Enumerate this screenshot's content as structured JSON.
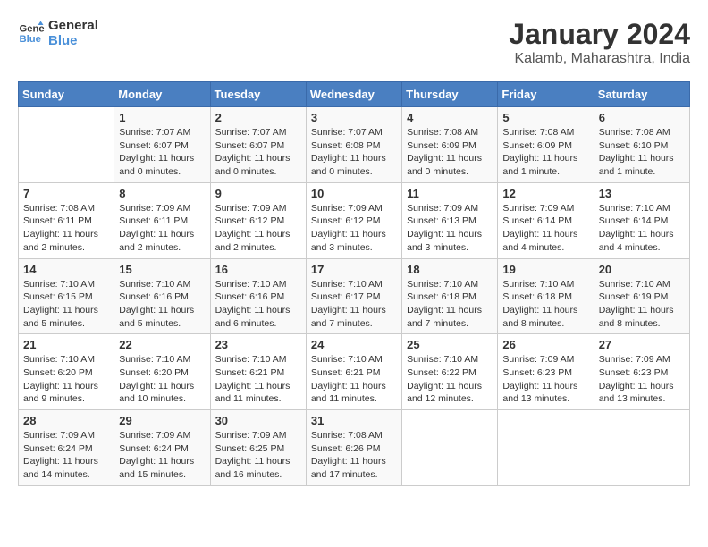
{
  "logo": {
    "line1": "General",
    "line2": "Blue"
  },
  "title": "January 2024",
  "location": "Kalamb, Maharashtra, India",
  "days_of_week": [
    "Sunday",
    "Monday",
    "Tuesday",
    "Wednesday",
    "Thursday",
    "Friday",
    "Saturday"
  ],
  "weeks": [
    [
      {
        "day": "",
        "info": ""
      },
      {
        "day": "1",
        "info": "Sunrise: 7:07 AM\nSunset: 6:07 PM\nDaylight: 11 hours\nand 0 minutes."
      },
      {
        "day": "2",
        "info": "Sunrise: 7:07 AM\nSunset: 6:07 PM\nDaylight: 11 hours\nand 0 minutes."
      },
      {
        "day": "3",
        "info": "Sunrise: 7:07 AM\nSunset: 6:08 PM\nDaylight: 11 hours\nand 0 minutes."
      },
      {
        "day": "4",
        "info": "Sunrise: 7:08 AM\nSunset: 6:09 PM\nDaylight: 11 hours\nand 0 minutes."
      },
      {
        "day": "5",
        "info": "Sunrise: 7:08 AM\nSunset: 6:09 PM\nDaylight: 11 hours\nand 1 minute."
      },
      {
        "day": "6",
        "info": "Sunrise: 7:08 AM\nSunset: 6:10 PM\nDaylight: 11 hours\nand 1 minute."
      }
    ],
    [
      {
        "day": "7",
        "info": "Sunrise: 7:08 AM\nSunset: 6:11 PM\nDaylight: 11 hours\nand 2 minutes."
      },
      {
        "day": "8",
        "info": "Sunrise: 7:09 AM\nSunset: 6:11 PM\nDaylight: 11 hours\nand 2 minutes."
      },
      {
        "day": "9",
        "info": "Sunrise: 7:09 AM\nSunset: 6:12 PM\nDaylight: 11 hours\nand 2 minutes."
      },
      {
        "day": "10",
        "info": "Sunrise: 7:09 AM\nSunset: 6:12 PM\nDaylight: 11 hours\nand 3 minutes."
      },
      {
        "day": "11",
        "info": "Sunrise: 7:09 AM\nSunset: 6:13 PM\nDaylight: 11 hours\nand 3 minutes."
      },
      {
        "day": "12",
        "info": "Sunrise: 7:09 AM\nSunset: 6:14 PM\nDaylight: 11 hours\nand 4 minutes."
      },
      {
        "day": "13",
        "info": "Sunrise: 7:10 AM\nSunset: 6:14 PM\nDaylight: 11 hours\nand 4 minutes."
      }
    ],
    [
      {
        "day": "14",
        "info": "Sunrise: 7:10 AM\nSunset: 6:15 PM\nDaylight: 11 hours\nand 5 minutes."
      },
      {
        "day": "15",
        "info": "Sunrise: 7:10 AM\nSunset: 6:16 PM\nDaylight: 11 hours\nand 5 minutes."
      },
      {
        "day": "16",
        "info": "Sunrise: 7:10 AM\nSunset: 6:16 PM\nDaylight: 11 hours\nand 6 minutes."
      },
      {
        "day": "17",
        "info": "Sunrise: 7:10 AM\nSunset: 6:17 PM\nDaylight: 11 hours\nand 7 minutes."
      },
      {
        "day": "18",
        "info": "Sunrise: 7:10 AM\nSunset: 6:18 PM\nDaylight: 11 hours\nand 7 minutes."
      },
      {
        "day": "19",
        "info": "Sunrise: 7:10 AM\nSunset: 6:18 PM\nDaylight: 11 hours\nand 8 minutes."
      },
      {
        "day": "20",
        "info": "Sunrise: 7:10 AM\nSunset: 6:19 PM\nDaylight: 11 hours\nand 8 minutes."
      }
    ],
    [
      {
        "day": "21",
        "info": "Sunrise: 7:10 AM\nSunset: 6:20 PM\nDaylight: 11 hours\nand 9 minutes."
      },
      {
        "day": "22",
        "info": "Sunrise: 7:10 AM\nSunset: 6:20 PM\nDaylight: 11 hours\nand 10 minutes."
      },
      {
        "day": "23",
        "info": "Sunrise: 7:10 AM\nSunset: 6:21 PM\nDaylight: 11 hours\nand 11 minutes."
      },
      {
        "day": "24",
        "info": "Sunrise: 7:10 AM\nSunset: 6:21 PM\nDaylight: 11 hours\nand 11 minutes."
      },
      {
        "day": "25",
        "info": "Sunrise: 7:10 AM\nSunset: 6:22 PM\nDaylight: 11 hours\nand 12 minutes."
      },
      {
        "day": "26",
        "info": "Sunrise: 7:09 AM\nSunset: 6:23 PM\nDaylight: 11 hours\nand 13 minutes."
      },
      {
        "day": "27",
        "info": "Sunrise: 7:09 AM\nSunset: 6:23 PM\nDaylight: 11 hours\nand 13 minutes."
      }
    ],
    [
      {
        "day": "28",
        "info": "Sunrise: 7:09 AM\nSunset: 6:24 PM\nDaylight: 11 hours\nand 14 minutes."
      },
      {
        "day": "29",
        "info": "Sunrise: 7:09 AM\nSunset: 6:24 PM\nDaylight: 11 hours\nand 15 minutes."
      },
      {
        "day": "30",
        "info": "Sunrise: 7:09 AM\nSunset: 6:25 PM\nDaylight: 11 hours\nand 16 minutes."
      },
      {
        "day": "31",
        "info": "Sunrise: 7:08 AM\nSunset: 6:26 PM\nDaylight: 11 hours\nand 17 minutes."
      },
      {
        "day": "",
        "info": ""
      },
      {
        "day": "",
        "info": ""
      },
      {
        "day": "",
        "info": ""
      }
    ]
  ]
}
